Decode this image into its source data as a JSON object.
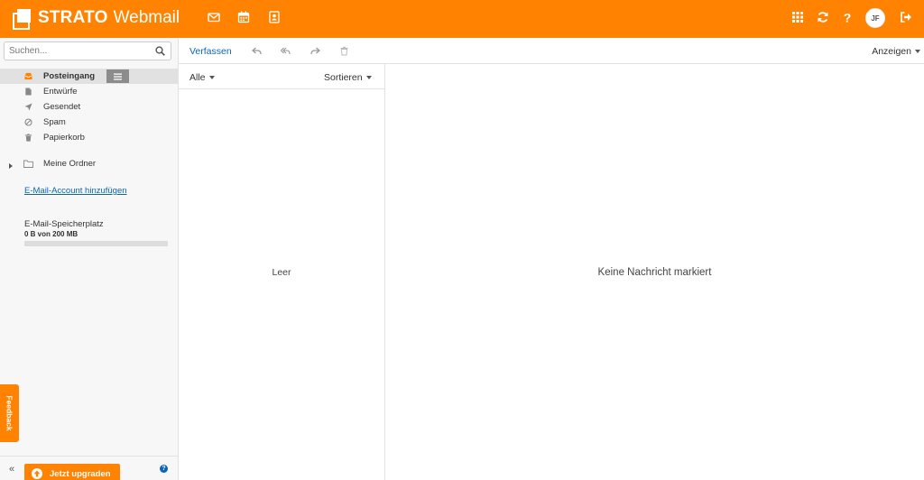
{
  "header": {
    "brand": "STRATO",
    "product": "Webmail",
    "nav_icons": [
      "mail-icon",
      "calendar-icon",
      "contacts-icon"
    ],
    "right_icons": [
      "apps-grid-icon",
      "refresh-icon",
      "help-icon",
      "logout-icon"
    ],
    "avatar_initials": "JF",
    "accent_color": "#ff8300"
  },
  "sidebar": {
    "search_placeholder": "Suchen...",
    "folders": [
      {
        "label": "Posteingang",
        "icon": "inbox-icon",
        "active": true
      },
      {
        "label": "Entwürfe",
        "icon": "draft-icon",
        "active": false
      },
      {
        "label": "Gesendet",
        "icon": "sent-icon",
        "active": false
      },
      {
        "label": "Spam",
        "icon": "spam-icon",
        "active": false
      },
      {
        "label": "Papierkorb",
        "icon": "trash-icon",
        "active": false
      }
    ],
    "my_folders": "Meine Ordner",
    "add_account": "E-Mail-Account hinzufügen",
    "storage_label": "E-Mail-Speicherplatz",
    "storage_value": "0 B von 200 MB",
    "storage_used_fraction": 0,
    "feedback": "Feedback",
    "upgrade": "Jetzt upgraden",
    "collapse": "«",
    "help": "?"
  },
  "toolbar": {
    "compose": "Verfassen",
    "icons": [
      "reply-icon",
      "reply-all-icon",
      "forward-icon",
      "delete-icon"
    ],
    "view": "Anzeigen"
  },
  "list": {
    "filter": "Alle",
    "sort": "Sortieren",
    "empty": "Leer"
  },
  "reading": {
    "empty": "Keine Nachricht markiert"
  }
}
